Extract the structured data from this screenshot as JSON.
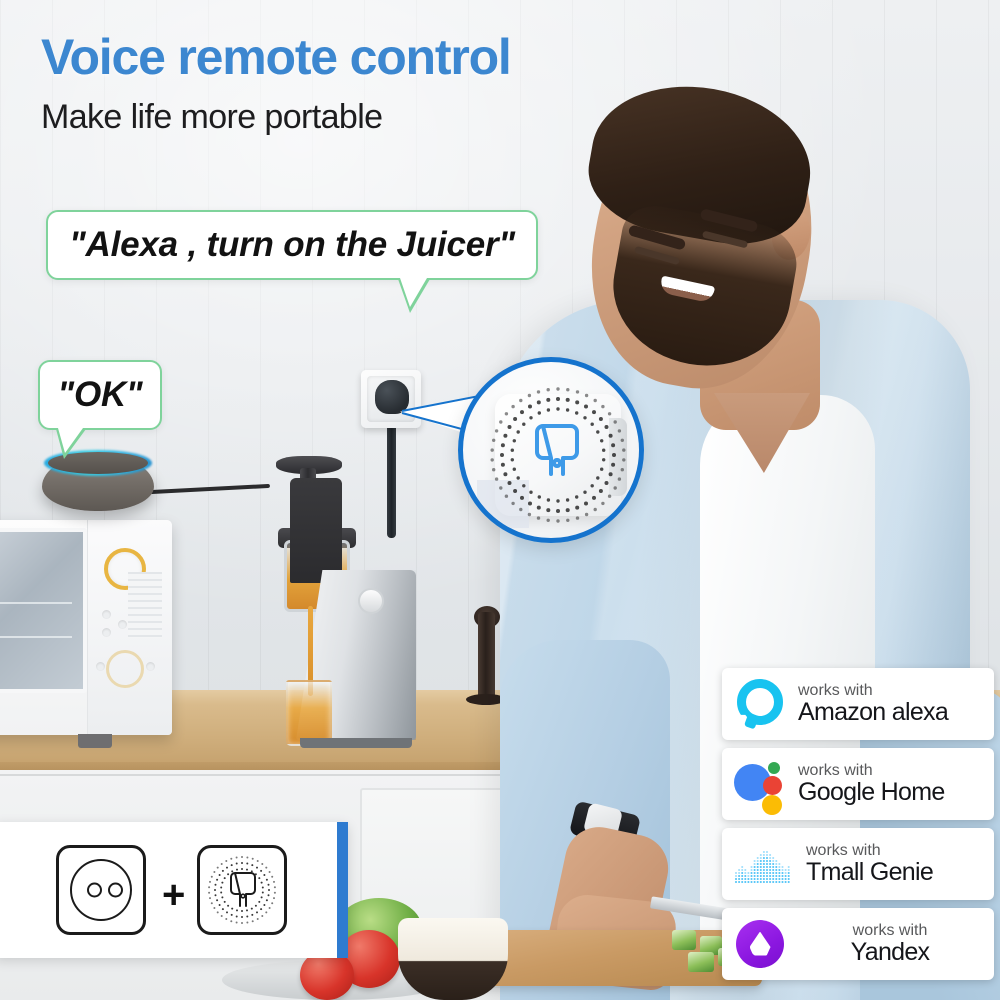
{
  "headline": {
    "title": "Voice remote control",
    "subtitle": "Make life more portable",
    "title_color": "#3c87d0",
    "subtitle_color": "#1d1d1f"
  },
  "speech_bubbles": [
    {
      "id": "command",
      "text": "\"Alexa , turn on the Juicer\"",
      "border_color": "#7fd39b",
      "background": "#ffffff"
    },
    {
      "id": "response",
      "text": "\"OK\"",
      "border_color": "#7fd39b",
      "background": "#ffffff"
    }
  ],
  "callout": {
    "name": "magnifier-zoom-on-smart-plug",
    "ring_color": "#1573cd",
    "device_glyph_color": "#3e9ae8"
  },
  "product_panel": {
    "plus_label": "+",
    "accent_color": "#2e7bd0",
    "icons": [
      {
        "name": "wall-socket-icon",
        "label": "EU wall socket"
      },
      {
        "name": "smart-plug-module-icon",
        "label": "Smart plug module"
      }
    ]
  },
  "badges": {
    "works_with_label": "works with",
    "items": [
      {
        "brand": "Amazon alexa",
        "logo": "alexa-logo",
        "logo_color": "#18c3f0",
        "align": "left"
      },
      {
        "brand": "Google Home",
        "logo": "google-assistant-logo",
        "logo_color": "#4285F4",
        "align": "left"
      },
      {
        "brand": "Tmall Genie",
        "logo": "tmall-genie-logo",
        "logo_color": "#4fc3f7",
        "align": "center"
      },
      {
        "brand": "Yandex",
        "logo": "yandex-alice-logo",
        "logo_color": "#8b17e0",
        "align": "center"
      }
    ]
  },
  "scene": {
    "description": "Bearded man in light blue shirt chopping cucumber in a kitchen",
    "objects": [
      "echo-dot-speaker",
      "microwave-oven",
      "slow-juicer",
      "juice-glass",
      "pepper-grinder",
      "wall-socket-with-plug",
      "cutting-board",
      "knife",
      "bowl",
      "tomatoes",
      "lettuce",
      "wood-countertop",
      "white-cabinets"
    ]
  }
}
